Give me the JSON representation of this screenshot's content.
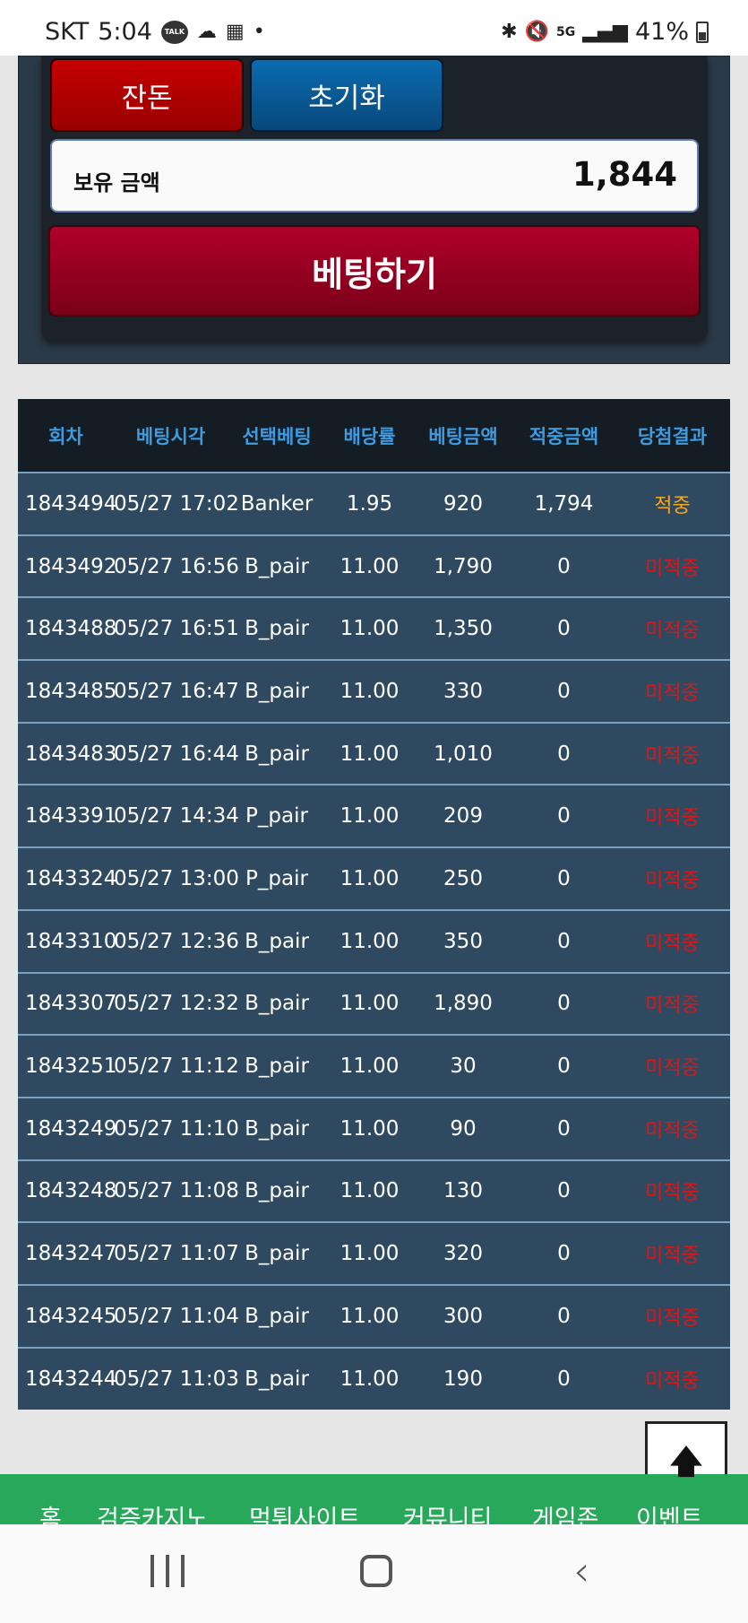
{
  "status_bar": {
    "carrier": "SKT",
    "time": "5:04",
    "talk_badge": "TALK",
    "network": "5G",
    "battery": "41%"
  },
  "panel": {
    "balance_button": "잔돈",
    "reset_button": "초기화",
    "holding_label": "보유 금액",
    "holding_value": "1,844",
    "bet_button": "베팅하기"
  },
  "table": {
    "headers": [
      "회차",
      "베팅시각",
      "선택베팅",
      "배당률",
      "베팅금액",
      "적중금액",
      "당첨결과"
    ],
    "rows": [
      {
        "round": "1843494",
        "time": "05/27 17:02",
        "pick": "Banker",
        "odds": "1.95",
        "bet": "920",
        "win": "1,794",
        "result": "적중",
        "is_win": true
      },
      {
        "round": "1843492",
        "time": "05/27 16:56",
        "pick": "B_pair",
        "odds": "11.00",
        "bet": "1,790",
        "win": "0",
        "result": "미적중",
        "is_win": false
      },
      {
        "round": "1843488",
        "time": "05/27 16:51",
        "pick": "B_pair",
        "odds": "11.00",
        "bet": "1,350",
        "win": "0",
        "result": "미적중",
        "is_win": false
      },
      {
        "round": "1843485",
        "time": "05/27 16:47",
        "pick": "B_pair",
        "odds": "11.00",
        "bet": "330",
        "win": "0",
        "result": "미적중",
        "is_win": false
      },
      {
        "round": "1843483",
        "time": "05/27 16:44",
        "pick": "B_pair",
        "odds": "11.00",
        "bet": "1,010",
        "win": "0",
        "result": "미적중",
        "is_win": false
      },
      {
        "round": "1843391",
        "time": "05/27 14:34",
        "pick": "P_pair",
        "odds": "11.00",
        "bet": "209",
        "win": "0",
        "result": "미적중",
        "is_win": false
      },
      {
        "round": "1843324",
        "time": "05/27 13:00",
        "pick": "P_pair",
        "odds": "11.00",
        "bet": "250",
        "win": "0",
        "result": "미적중",
        "is_win": false
      },
      {
        "round": "1843310",
        "time": "05/27 12:36",
        "pick": "B_pair",
        "odds": "11.00",
        "bet": "350",
        "win": "0",
        "result": "미적중",
        "is_win": false
      },
      {
        "round": "1843307",
        "time": "05/27 12:32",
        "pick": "B_pair",
        "odds": "11.00",
        "bet": "1,890",
        "win": "0",
        "result": "미적중",
        "is_win": false
      },
      {
        "round": "1843251",
        "time": "05/27 11:12",
        "pick": "B_pair",
        "odds": "11.00",
        "bet": "30",
        "win": "0",
        "result": "미적중",
        "is_win": false
      },
      {
        "round": "1843249",
        "time": "05/27 11:10",
        "pick": "B_pair",
        "odds": "11.00",
        "bet": "90",
        "win": "0",
        "result": "미적중",
        "is_win": false
      },
      {
        "round": "1843248",
        "time": "05/27 11:08",
        "pick": "B_pair",
        "odds": "11.00",
        "bet": "130",
        "win": "0",
        "result": "미적중",
        "is_win": false
      },
      {
        "round": "1843247",
        "time": "05/27 11:07",
        "pick": "B_pair",
        "odds": "11.00",
        "bet": "320",
        "win": "0",
        "result": "미적중",
        "is_win": false
      },
      {
        "round": "1843245",
        "time": "05/27 11:04",
        "pick": "B_pair",
        "odds": "11.00",
        "bet": "300",
        "win": "0",
        "result": "미적중",
        "is_win": false
      },
      {
        "round": "1843244",
        "time": "05/27 11:03",
        "pick": "B_pair",
        "odds": "11.00",
        "bet": "190",
        "win": "0",
        "result": "미적중",
        "is_win": false
      }
    ]
  },
  "bottom_nav": {
    "items": [
      "홈",
      "검증카지노",
      "먹튀사이트",
      "커뮤니티",
      "게임존",
      "이벤트"
    ]
  },
  "colors": {
    "win": "#f5a623",
    "lose": "#d81818",
    "header_text": "#3f9be0",
    "nav_green": "#27a85a"
  }
}
